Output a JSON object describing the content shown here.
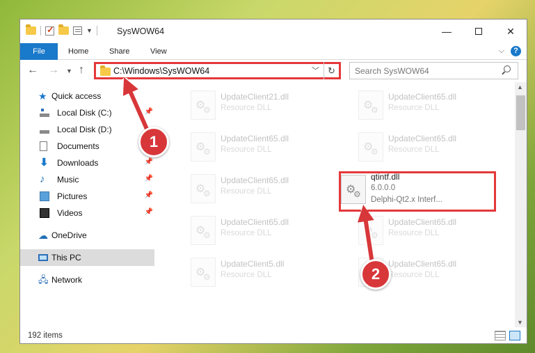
{
  "window": {
    "title": "SysWOW64",
    "controls": {
      "minimize": "—",
      "maximize": "",
      "close": "✕"
    }
  },
  "ribbon": {
    "tabs": [
      "File",
      "Home",
      "Share",
      "View"
    ]
  },
  "address_bar": {
    "path": "C:\\Windows\\SysWOW64",
    "refresh_glyph": "↻",
    "dropdown_glyph": "﹀"
  },
  "search": {
    "placeholder": "Search SysWOW64"
  },
  "nav_pane": {
    "items": [
      {
        "label": "Quick access",
        "icon": "star-icon"
      },
      {
        "label": "Local Disk (C:)",
        "icon": "drive-icon",
        "pinned": true
      },
      {
        "label": "Local Disk (D:)",
        "icon": "drive-icon",
        "pinned": false
      },
      {
        "label": "Documents",
        "icon": "document-icon",
        "pinned": true
      },
      {
        "label": "Downloads",
        "icon": "download-icon",
        "pinned": true
      },
      {
        "label": "Music",
        "icon": "music-icon",
        "pinned": true
      },
      {
        "label": "Pictures",
        "icon": "picture-icon",
        "pinned": true
      },
      {
        "label": "Videos",
        "icon": "video-icon",
        "pinned": true
      },
      {
        "label": "OneDrive",
        "icon": "cloud-icon"
      },
      {
        "label": "This PC",
        "icon": "computer-icon",
        "selected": true
      },
      {
        "label": "Network",
        "icon": "network-icon"
      }
    ]
  },
  "files": {
    "left": [
      {
        "name": "UpdateClient21.dll",
        "desc": "Resource DLL"
      },
      {
        "name": "UpdateClient65.dll",
        "desc": "Resource DLL"
      },
      {
        "name": "UpdateClient65.dll",
        "desc": "Resource DLL"
      },
      {
        "name": "UpdateClient65.dll",
        "desc": "Resource DLL"
      },
      {
        "name": "UpdateClient5.dll",
        "desc": "Resource DLL"
      }
    ],
    "right": [
      {
        "name": "UpdateClient65.dll",
        "desc": "Resource DLL"
      },
      {
        "name": "UpdateClient65.dll",
        "desc": "Resource DLL"
      },
      {
        "name": "qtintf.dll",
        "version": "6.0.0.0",
        "desc": "Delphi-Qt2.x Interf..."
      },
      {
        "name": "UpdateClient65.dll",
        "desc": "Resource DLL"
      },
      {
        "name": "UpdateClient65.dll",
        "desc": "Resource DLL"
      }
    ]
  },
  "status_bar": {
    "item_count": "192 items"
  },
  "annotations": {
    "step1": "1",
    "step2": "2",
    "highlight_color": "#e4383a"
  },
  "colors": {
    "accent": "#1979ca"
  }
}
